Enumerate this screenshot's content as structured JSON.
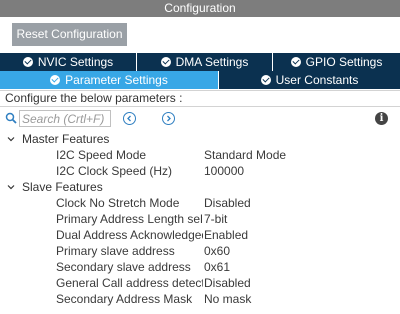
{
  "window": {
    "title": "Configuration"
  },
  "toolbar": {
    "reset_label": "Reset Configuration"
  },
  "tabs_row1": [
    {
      "label": "NVIC Settings"
    },
    {
      "label": "DMA Settings"
    },
    {
      "label": "GPIO Settings"
    }
  ],
  "tabs_row2": [
    {
      "label": "Parameter Settings",
      "active": true
    },
    {
      "label": "User Constants"
    }
  ],
  "params_header": "Configure the below parameters :",
  "search": {
    "placeholder": "Search (Crtl+F)"
  },
  "groups": [
    {
      "label": "Master Features",
      "params": [
        {
          "name": "I2C Speed Mode",
          "value": "Standard Mode"
        },
        {
          "name": "I2C Clock Speed (Hz)",
          "value": "100000"
        }
      ]
    },
    {
      "label": "Slave Features",
      "params": [
        {
          "name": "Clock No Stretch Mode",
          "value": "Disabled"
        },
        {
          "name": "Primary Address Length sele...",
          "value": "7-bit"
        },
        {
          "name": "Dual Address Acknowledged",
          "value": "Enabled"
        },
        {
          "name": "Primary slave address",
          "value": "0x60"
        },
        {
          "name": "Secondary slave address",
          "value": "0x61"
        },
        {
          "name": "General Call address detection",
          "value": "Disabled"
        },
        {
          "name": "Secondary Address Mask",
          "value": "No mask"
        }
      ]
    }
  ],
  "colors": {
    "title_bar": "#7d7d7d",
    "tab_dark": "#0b3150",
    "tab_active": "#38a7e6",
    "button": "#9aa0a6"
  }
}
